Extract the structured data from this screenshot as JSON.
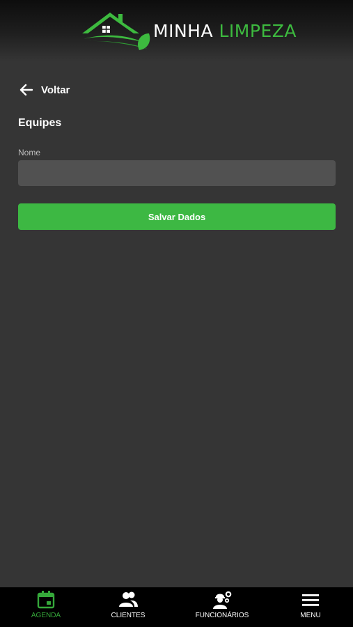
{
  "header": {
    "logo_word1": "MINHA",
    "logo_word2": "LIMPEZA",
    "brand_color": "#3dba3f"
  },
  "back": {
    "label": "Voltar",
    "icon": "arrow-left-icon"
  },
  "page": {
    "title": "Equipes"
  },
  "form": {
    "name_label": "Nome",
    "name_value": "",
    "name_placeholder": "",
    "save_label": "Salvar Dados"
  },
  "nav": {
    "active_color": "#35a83a",
    "items": [
      {
        "label": "AGENDA",
        "icon": "calendar-icon",
        "active": true
      },
      {
        "label": "CLIENTES",
        "icon": "users-icon",
        "active": false
      },
      {
        "label": "FUNCIONÁRIOS",
        "icon": "worker-gear-icon",
        "active": false
      },
      {
        "label": "MENU",
        "icon": "hamburger-menu-icon",
        "active": false
      }
    ]
  }
}
